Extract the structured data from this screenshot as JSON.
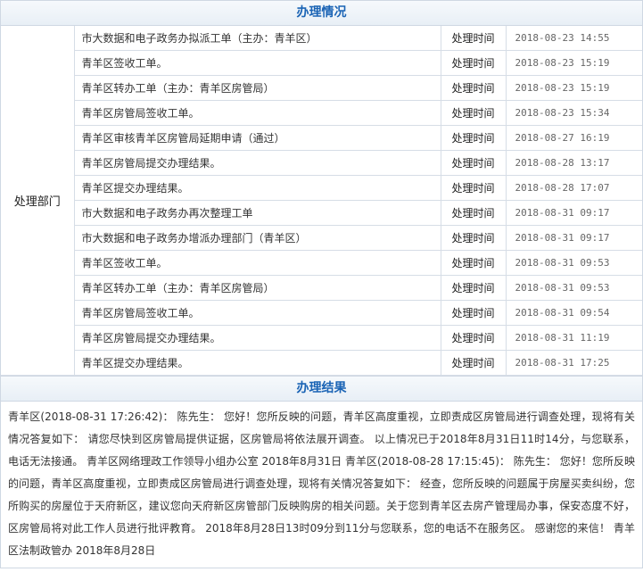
{
  "processing": {
    "header": "办理情况",
    "department_label": "处理部门",
    "time_label": "处理时间",
    "rows": [
      {
        "action": "市大数据和电子政务办拟派工单（主办：青羊区）",
        "time": "2018-08-23 14:55"
      },
      {
        "action": "青羊区签收工单。",
        "time": "2018-08-23 15:19"
      },
      {
        "action": "青羊区转办工单（主办：青羊区房管局）",
        "time": "2018-08-23 15:19"
      },
      {
        "action": "青羊区房管局签收工单。",
        "time": "2018-08-23 15:34"
      },
      {
        "action": "青羊区审核青羊区房管局延期申请（通过）",
        "time": "2018-08-27 16:19"
      },
      {
        "action": "青羊区房管局提交办理结果。",
        "time": "2018-08-28 13:17"
      },
      {
        "action": "青羊区提交办理结果。",
        "time": "2018-08-28 17:07"
      },
      {
        "action": "市大数据和电子政务办再次整理工单",
        "time": "2018-08-31 09:17"
      },
      {
        "action": "市大数据和电子政务办增派办理部门（青羊区）",
        "time": "2018-08-31 09:17"
      },
      {
        "action": "青羊区签收工单。",
        "time": "2018-08-31 09:53"
      },
      {
        "action": "青羊区转办工单（主办：青羊区房管局）",
        "time": "2018-08-31 09:53"
      },
      {
        "action": "青羊区房管局签收工单。",
        "time": "2018-08-31 09:54"
      },
      {
        "action": "青羊区房管局提交办理结果。",
        "time": "2018-08-31 11:19"
      },
      {
        "action": "青羊区提交办理结果。",
        "time": "2018-08-31 17:25"
      }
    ]
  },
  "result": {
    "header": "办理结果",
    "text": "青羊区(2018-08-31 17:26:42)： 陈先生： 您好！您所反映的问题，青羊区高度重视，立即责成区房管局进行调查处理，现将有关情况答复如下： 请您尽快到区房管局提供证据，区房管局将依法展开调查。 以上情况已于2018年8月31日11时14分，与您联系，电话无法接通。 青羊区网络理政工作领导小组办公室 2018年8月31日 青羊区(2018-08-28 17:15:45)： 陈先生： 您好！您所反映的问题，青羊区高度重视，立即责成区房管局进行调查处理，现将有关情况答复如下： 经查，您所反映的问题属于房屋买卖纠纷，您所购买的房屋位于天府新区，建议您向天府新区房管部门反映购房的相关问题。关于您到青羊区去房产管理局办事，保安态度不好，区房管局将对此工作人员进行批评教育。 2018年8月28日13时09分到11分与您联系，您的电话不在服务区。 感谢您的来信！ 青羊区法制政管办 2018年8月28日"
  }
}
